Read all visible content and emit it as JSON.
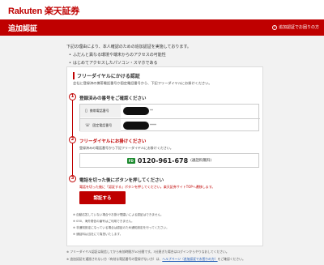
{
  "header": {
    "logo": "Rakuten 楽天証券"
  },
  "titlebar": {
    "title": "追加認証",
    "help": "追加認証でお困りの方"
  },
  "intro": {
    "lead": "下記の理由により、本人確認のための追加認証を実施しております。",
    "reasons": [
      "ふだんと異なる環境や端末からのアクセスの可能性",
      "はじめてアクセスしたパソコン・スマホである"
    ]
  },
  "card": {
    "title": "フリーダイヤルにかける認証",
    "desc": "会社に登録済の携帯電話番号か固定電話番号から、下記フリーダイヤルにお掛けください。",
    "step1": {
      "num": "1",
      "title": "登録済みの番号をご確認ください",
      "rows": [
        {
          "icon": "▯",
          "label": "携帯電話番号",
          "suffix": "**"
        },
        {
          "icon": "☏",
          "label": "固定電話番号",
          "suffix": "****"
        }
      ]
    },
    "step2": {
      "num": "2",
      "title": "フリーダイヤルにお掛けください",
      "sub": "登録済みの電話番号から下記フリーダイヤルにお掛けください。",
      "fd": "FD",
      "number": "0120-961-678",
      "note": "(通話料無料)"
    },
    "step3": {
      "num": "3",
      "title": "電話を切った後にボタンを押してください",
      "warn": "電話を切った後に「認証する」ボタンを押してください。楽天証券サイトTOPへ遷移します。",
      "button": "認証する"
    },
    "notes": [
      "自動応答していない場合やお掛け間違いによる認証はできません。",
      "050、海外発信の番号はご利用できません。",
      "非通知設定になっている場合は認証のため通知設定を行ってください。",
      "通話料は当社にて負担いたします。"
    ]
  },
  "footnotes": {
    "line1": "フリーダイヤル認証は発信してから有効時間が10分間です。3分過ぎた場合はログインからやりなおしてください。",
    "line2_pre": "追加認証を通過されない方（有効な電話番号の登録がない方）は、",
    "line2_link": "ヘルプページ（追加認証でお困りの方）",
    "line2_post": "をご確認ください。"
  }
}
